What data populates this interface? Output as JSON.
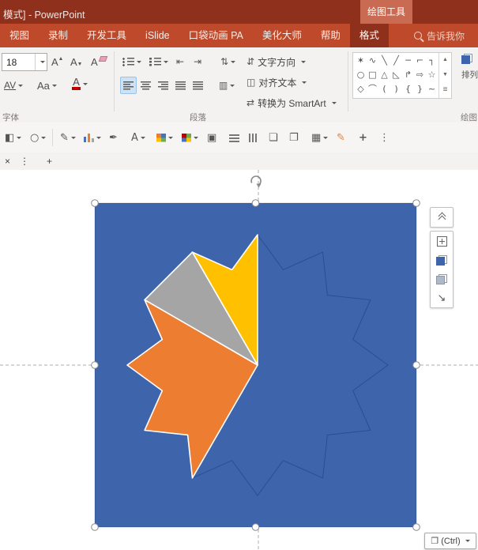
{
  "theme_vars": {
    "titlebar": "#8F301C",
    "contextual": "#C96B52",
    "tabs-bg": "#BE4A2B",
    "active-tab": "#8F301C",
    "ribbon-bg": "#F4F2F1",
    "shape-blue": "#3E65AC",
    "shape-stroke": "#2A4D8F",
    "wedge-yellow": "#FFC000",
    "wedge-gray": "#A5A5A5",
    "wedge-orange": "#ED7D31",
    "guide": "#ADADAD"
  },
  "window": {
    "title": "模式] - PowerPoint",
    "contextual_tab": "绘图工具",
    "search_hint": "告诉我你"
  },
  "menu_tabs": {
    "items": [
      "视图",
      "录制",
      "开发工具",
      "iSlide",
      "口袋动画 PA",
      "美化大师",
      "帮助",
      "格式"
    ],
    "active": "格式"
  },
  "ribbon": {
    "font_group": {
      "label": "字体",
      "font_size": "18",
      "grow_label": "A",
      "shrink_label": "A",
      "clear_label": "A",
      "spacing_label": "AV",
      "case_label": "Aa",
      "color_label": "A"
    },
    "paragraph_group": {
      "label": "段落",
      "text_direction_label": "文字方向",
      "align_text_label": "对齐文本",
      "smartart_label": "转换为 SmartArt"
    },
    "drawing_group": {
      "label": "绘图",
      "arrange_label": "排列",
      "gallery": {
        "row1": [
          "✶",
          "∿",
          "╲",
          "╱",
          "─",
          "⌐",
          "┐"
        ],
        "row2": [
          "○",
          "□",
          "△",
          "◺",
          "↱",
          "⇨",
          "☆"
        ],
        "row3": [
          "◇",
          "⌒",
          "(",
          ")",
          "{",
          "}",
          "~"
        ]
      },
      "scroll_up": "▲",
      "scroll_down": "▼",
      "gallery_more": "≡"
    }
  },
  "glyphs": {
    "indent_dec": "⇤",
    "indent_inc": "⇥",
    "line_spacing": "⇅",
    "columns": "▥",
    "text_direction": "⇵",
    "align_text": "◫",
    "smartart": "⇄"
  },
  "quick_toolbar": {
    "fill": "◧",
    "outline": "○",
    "pen": "✎",
    "dropper": "✒",
    "font": "A",
    "slide": "▣",
    "copy": "❏",
    "paste": "❐",
    "gallery": "▦",
    "marker": "✎",
    "select": "+",
    "more": "⋮"
  },
  "doc_tabbar": {
    "close": "×",
    "more": "⋮",
    "add": "+"
  },
  "side_panel": {
    "diag_arrow": "↘"
  },
  "paste_options": {
    "icon": "❐",
    "label": "(Ctrl)"
  }
}
